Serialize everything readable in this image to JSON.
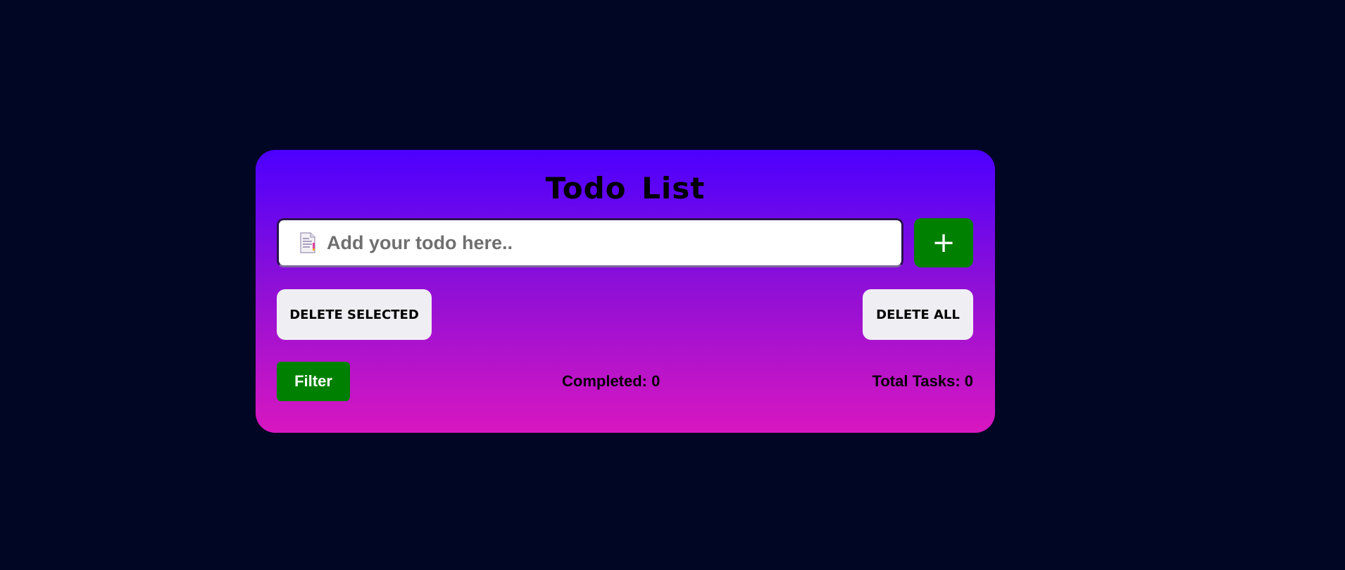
{
  "app": {
    "title": "Todo List"
  },
  "input": {
    "placeholder": "Add your todo here..",
    "value": "",
    "icon": "notepad-icon"
  },
  "buttons": {
    "add_label": "+",
    "delete_selected_label": "DELETE SELECTED",
    "delete_all_label": "DELETE ALL",
    "filter_label": "Filter"
  },
  "stats": {
    "completed_text": "Completed: 0",
    "total_text": "Total Tasks: 0"
  },
  "colors": {
    "background": "#020625",
    "card_gradient_top": "#4c00ff",
    "card_gradient_bottom": "#d817c0",
    "accent_green": "#008000",
    "light_button": "#efeef2"
  }
}
